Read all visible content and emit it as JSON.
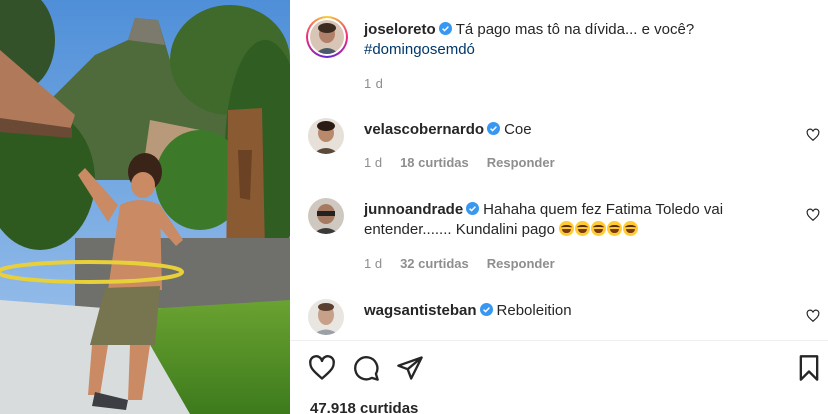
{
  "post": {
    "author": "joseloreto",
    "caption": "Tá pago mas tô na dívida... e você?",
    "hashtag": "#domingosemdó",
    "time": "1 d",
    "likes": "47.918 curtidas"
  },
  "comments": [
    {
      "user": "velascobernardo",
      "text": "Coe",
      "time": "1 d",
      "likes": "18 curtidas",
      "reply": "Responder"
    },
    {
      "user": "junnoandrade",
      "text": "Hahaha quem fez Fatima Toledo vai entender....... Kundalini pago",
      "emoji_count": 5,
      "time": "1 d",
      "likes": "32 curtidas",
      "reply": "Responder"
    },
    {
      "user": "wagsantisteban",
      "text": "Reboleition"
    }
  ],
  "icons": {
    "like": "heart-icon",
    "comment": "comment-icon",
    "share": "share-icon",
    "save": "bookmark-icon",
    "verified": "verified-badge-icon",
    "comment_like": "heart-icon"
  },
  "colors": {
    "verified": "#3897f0",
    "hashtag": "#00376b",
    "muted": "#8e8e8e",
    "text": "#262626"
  }
}
